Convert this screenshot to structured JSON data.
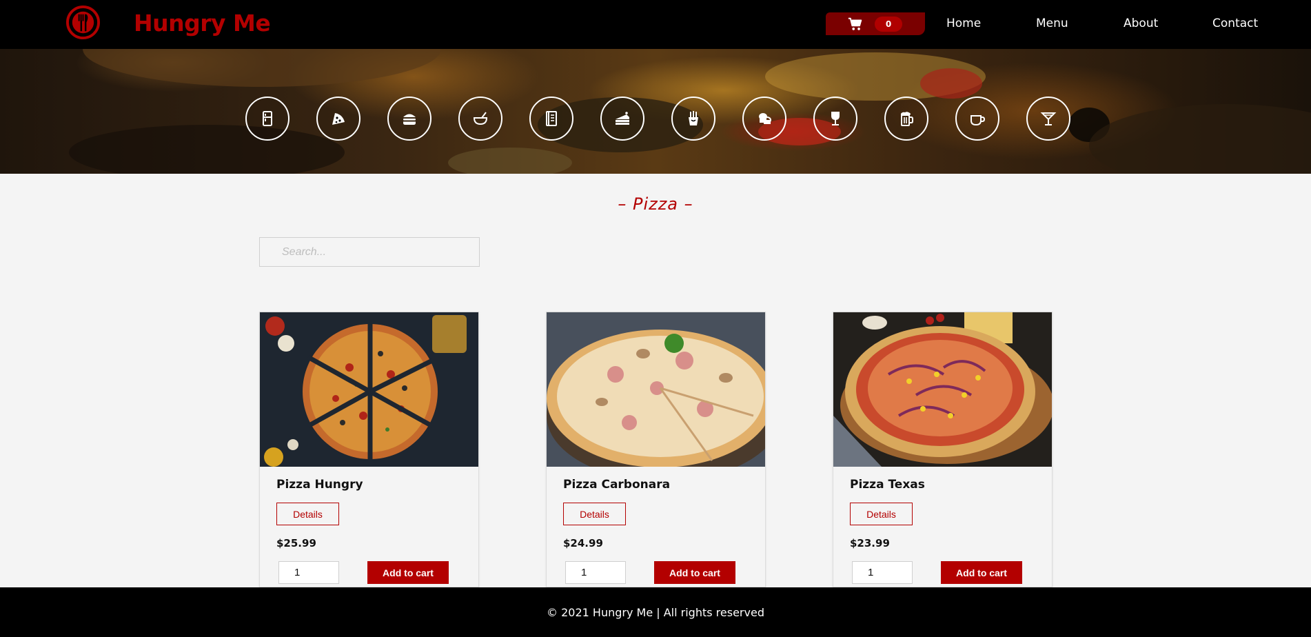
{
  "header": {
    "brand": "Hungry Me",
    "logo_icon": "restaurant-logo-icon",
    "cart": {
      "icon": "cart-icon",
      "count": "0"
    },
    "nav": [
      "Home",
      "Menu",
      "About",
      "Contact"
    ]
  },
  "categories": [
    {
      "icon": "fridge-icon"
    },
    {
      "icon": "pizza-icon"
    },
    {
      "icon": "burger-icon"
    },
    {
      "icon": "bowl-icon"
    },
    {
      "icon": "menu-book-icon"
    },
    {
      "icon": "cake-icon"
    },
    {
      "icon": "fries-icon"
    },
    {
      "icon": "bread-icon"
    },
    {
      "icon": "wine-glass-icon"
    },
    {
      "icon": "beer-mug-icon"
    },
    {
      "icon": "coffee-cup-icon"
    },
    {
      "icon": "cocktail-icon"
    }
  ],
  "section": {
    "title": "– Pizza –"
  },
  "search": {
    "placeholder": "Search..."
  },
  "products": [
    {
      "name": "Pizza Hungry",
      "details_label": "Details",
      "price": "$25.99",
      "qty": "1",
      "add_label": "Add to cart"
    },
    {
      "name": "Pizza Carbonara",
      "details_label": "Details",
      "price": "$24.99",
      "qty": "1",
      "add_label": "Add to cart"
    },
    {
      "name": "Pizza Texas",
      "details_label": "Details",
      "price": "$23.99",
      "qty": "1",
      "add_label": "Add to cart"
    }
  ],
  "footer": {
    "text": "© 2021 Hungry Me | All rights reserved"
  },
  "colors": {
    "brand": "#b30000",
    "header_bg": "#000000",
    "page_bg": "#f4f4f4",
    "cart_bg": "#7a0000"
  }
}
